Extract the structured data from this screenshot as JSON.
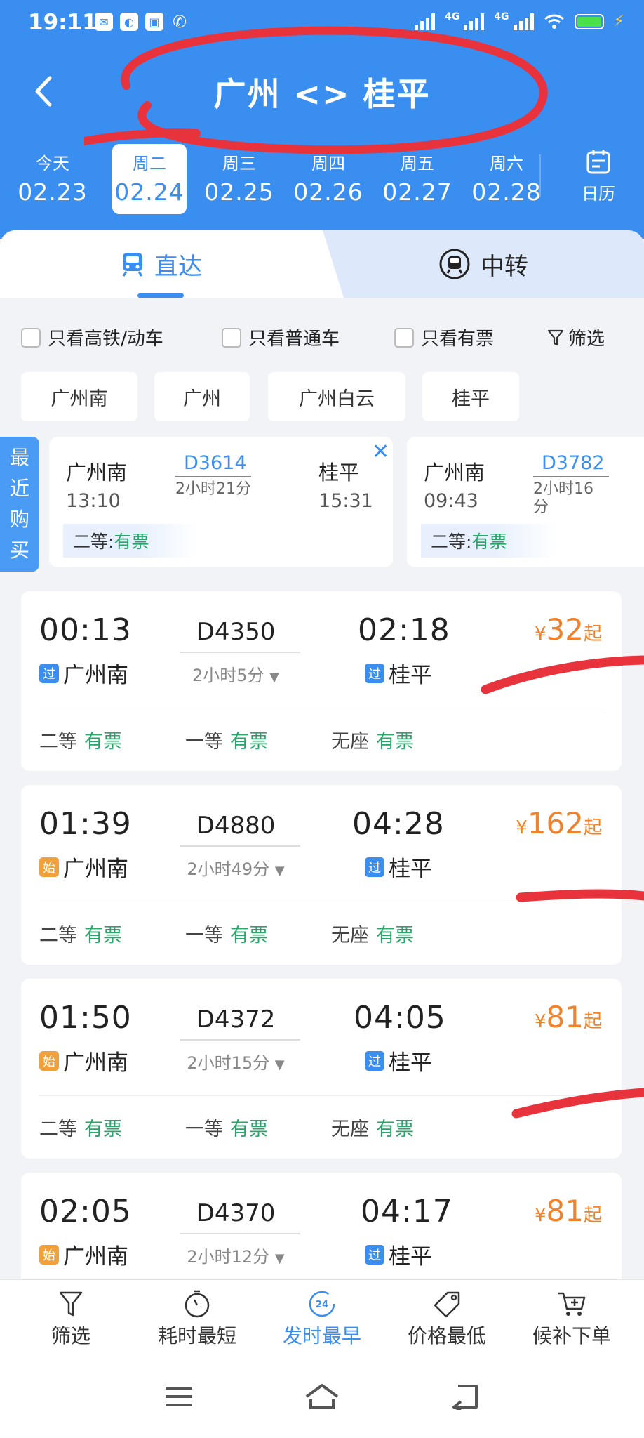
{
  "status_bar": {
    "time": "19:11",
    "net_label_1": "4G",
    "net_label_2": "4G"
  },
  "header": {
    "title": "广州 <> 桂平",
    "back_icon": "chevron-left-icon"
  },
  "dates": [
    {
      "dow": "今天",
      "date": "02.23",
      "active": false
    },
    {
      "dow": "周二",
      "date": "02.24",
      "active": true
    },
    {
      "dow": "周三",
      "date": "02.25",
      "active": false
    },
    {
      "dow": "周四",
      "date": "02.26",
      "active": false
    },
    {
      "dow": "周五",
      "date": "02.27",
      "active": false
    },
    {
      "dow": "周六",
      "date": "02.28",
      "active": false
    }
  ],
  "calendar": {
    "label": "日历"
  },
  "tabs": {
    "direct": "直达",
    "transfer": "中转"
  },
  "filters": {
    "high_speed_only": "只看高铁/动车",
    "regular_only": "只看普通车",
    "available_only": "只看有票",
    "filter": "筛选"
  },
  "stations": [
    "广州南",
    "广州",
    "广州白云",
    "桂平"
  ],
  "recent": {
    "label": [
      "最",
      "近",
      "购",
      "买"
    ],
    "cards": [
      {
        "from": "广州南",
        "from_time": "13:10",
        "train": "D3614",
        "duration": "2小时21分",
        "to": "桂平",
        "to_time": "15:31",
        "seat_class": "二等:",
        "status": "有票"
      },
      {
        "from": "广州南",
        "from_time": "09:43",
        "train": "D3782",
        "duration": "2小时16分",
        "seat_class": "二等:",
        "status": "有票"
      }
    ]
  },
  "trains": [
    {
      "dep": "00:13",
      "from_badge": "过",
      "from": "广州南",
      "train": "D4350",
      "duration": "2小时5分",
      "arr": "02:18",
      "to_badge": "过",
      "to": "桂平",
      "price_currency": "¥",
      "price": "32",
      "price_suffix": "起",
      "seats": [
        {
          "cls": "二等",
          "status": "有票"
        },
        {
          "cls": "一等",
          "status": "有票"
        },
        {
          "cls": "无座",
          "status": "有票"
        }
      ]
    },
    {
      "dep": "01:39",
      "from_badge": "始",
      "from": "广州南",
      "train": "D4880",
      "duration": "2小时49分",
      "arr": "04:28",
      "to_badge": "过",
      "to": "桂平",
      "price_currency": "¥",
      "price": "162",
      "price_suffix": "起",
      "seats": [
        {
          "cls": "二等",
          "status": "有票"
        },
        {
          "cls": "一等",
          "status": "有票"
        },
        {
          "cls": "无座",
          "status": "有票"
        }
      ]
    },
    {
      "dep": "01:50",
      "from_badge": "始",
      "from": "广州南",
      "train": "D4372",
      "duration": "2小时15分",
      "arr": "04:05",
      "to_badge": "过",
      "to": "桂平",
      "price_currency": "¥",
      "price": "81",
      "price_suffix": "起",
      "seats": [
        {
          "cls": "二等",
          "status": "有票"
        },
        {
          "cls": "一等",
          "status": "有票"
        },
        {
          "cls": "无座",
          "status": "有票"
        }
      ]
    },
    {
      "dep": "02:05",
      "from_badge": "始",
      "from": "广州南",
      "train": "D4370",
      "duration": "2小时12分",
      "arr": "04:17",
      "to_badge": "过",
      "to": "桂平",
      "price_currency": "¥",
      "price": "81",
      "price_suffix": "起",
      "seats": []
    }
  ],
  "toolbar": {
    "filter": "筛选",
    "shortest": "耗时最短",
    "earliest": "发时最早",
    "earliest_icon_text": "24",
    "cheapest": "价格最低",
    "waitlist": "候补下单"
  },
  "colors": {
    "header_blue": "#3a8ef0",
    "price_orange": "#f0822c",
    "available_green": "#2aa56a",
    "annotation_red": "#e8323c"
  }
}
